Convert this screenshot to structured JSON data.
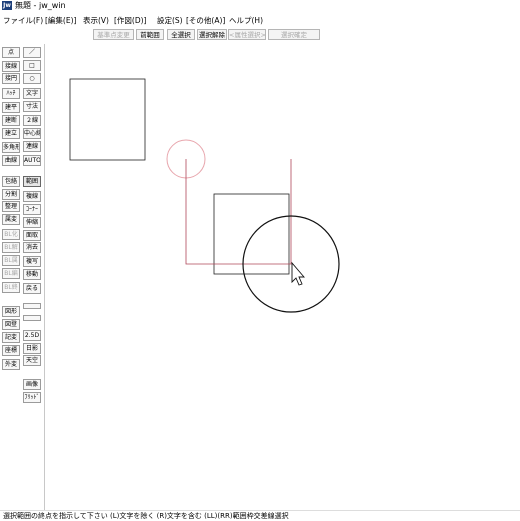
{
  "window": {
    "app_icon_text": "Jw",
    "title": "無題 - jw_win"
  },
  "menu": [
    "ファイル(F)",
    "[編集(E)]",
    "表示(V)",
    "[作図(D)]",
    "設定(S)",
    "[その他(A)]",
    "ヘルプ(H)"
  ],
  "toolbar": {
    "buttons": [
      {
        "label": "基準点変更",
        "enabled": false
      },
      {
        "label": "前範囲",
        "enabled": true
      },
      {
        "label": "全選択",
        "enabled": true
      },
      {
        "label": "選択解除",
        "enabled": true
      },
      {
        "label": "<属性選択>",
        "enabled": false
      },
      {
        "label": "選択確定",
        "enabled": false
      }
    ]
  },
  "toolbox": {
    "left_column": [
      {
        "label": "点",
        "enabled": true
      },
      {
        "label": "接線",
        "enabled": true
      },
      {
        "label": "接円",
        "enabled": true
      },
      {
        "label": "ﾊｯﾁ",
        "enabled": true
      },
      {
        "label": "建平",
        "enabled": true
      },
      {
        "label": "建断",
        "enabled": true
      },
      {
        "label": "建立",
        "enabled": true
      },
      {
        "label": "多角形",
        "enabled": true
      },
      {
        "label": "曲線",
        "enabled": true
      },
      {
        "label": "包絡",
        "enabled": true
      },
      {
        "label": "分割",
        "enabled": true
      },
      {
        "label": "整理",
        "enabled": true
      },
      {
        "label": "属変",
        "enabled": true
      },
      {
        "label": "BL化",
        "enabled": false
      },
      {
        "label": "BL解",
        "enabled": false
      },
      {
        "label": "BL属",
        "enabled": false
      },
      {
        "label": "BL編",
        "enabled": false
      },
      {
        "label": "BL終",
        "enabled": false
      },
      {
        "label": "図形",
        "enabled": true
      },
      {
        "label": "図登",
        "enabled": true
      },
      {
        "label": "記変",
        "enabled": true
      },
      {
        "label": "座標",
        "enabled": true
      },
      {
        "label": "外変",
        "enabled": true
      }
    ],
    "right_column": [
      {
        "label": "／",
        "enabled": true
      },
      {
        "label": "□",
        "enabled": true
      },
      {
        "label": "○",
        "enabled": true
      },
      {
        "label": "文字",
        "enabled": true
      },
      {
        "label": "寸法",
        "enabled": true
      },
      {
        "label": "２線",
        "enabled": true
      },
      {
        "label": "中心線",
        "enabled": true
      },
      {
        "label": "連線",
        "enabled": true
      },
      {
        "label": "AUTO",
        "enabled": true
      },
      {
        "label": "範囲",
        "enabled": true,
        "selected": true
      },
      {
        "label": "複線",
        "enabled": true
      },
      {
        "label": "ｺｰﾅｰ",
        "enabled": true
      },
      {
        "label": "伸縮",
        "enabled": true
      },
      {
        "label": "面取",
        "enabled": true
      },
      {
        "label": "消去",
        "enabled": true
      },
      {
        "label": "複写",
        "enabled": true
      },
      {
        "label": "移動",
        "enabled": true
      },
      {
        "label": "戻る",
        "enabled": true
      },
      {
        "label": "",
        "enabled": true
      },
      {
        "label": "",
        "enabled": true
      },
      {
        "label": "2.5D",
        "enabled": true
      },
      {
        "label": "日影",
        "enabled": true
      },
      {
        "label": "天空",
        "enabled": true
      },
      {
        "label": "画像",
        "enabled": true
      },
      {
        "label": "ﾌﾘｯﾄﾞ",
        "enabled": true
      }
    ]
  },
  "canvas": {
    "selection_color": "#b0475a",
    "cursor_ring_color": "#e8a6ad"
  },
  "status": {
    "text": "選択範囲の終点を指示して下さい (L)文字を除く (R)文字を含む   (LL)(RR)範囲枠交差線選択"
  }
}
